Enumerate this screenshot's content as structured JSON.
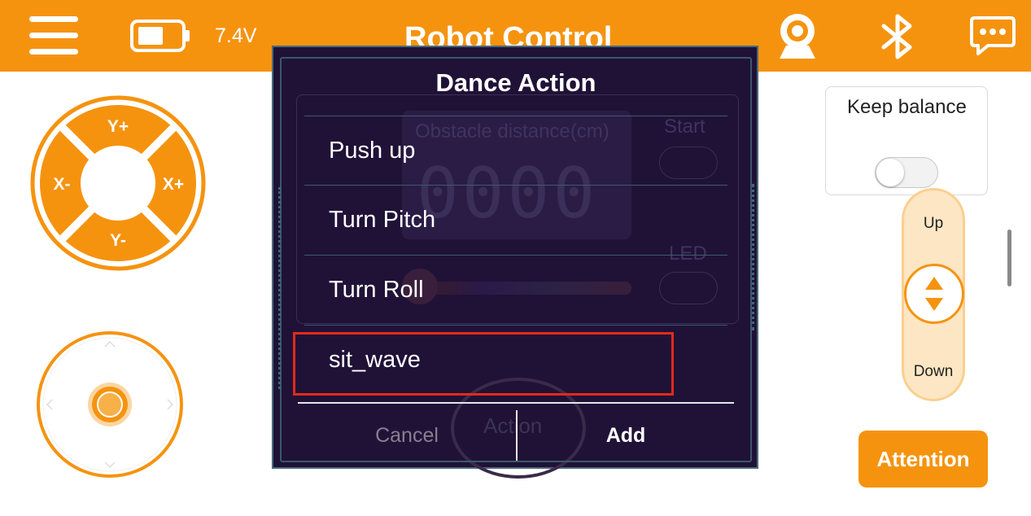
{
  "header": {
    "voltage": "7.4V",
    "title": "Robot Control",
    "icons": [
      "menu-icon",
      "battery-icon",
      "camera-icon",
      "bluetooth-icon",
      "chat-icon"
    ]
  },
  "dpad": {
    "up": "Y+",
    "down": "Y-",
    "left": "X-",
    "right": "X+"
  },
  "keep_balance": {
    "label": "Keep balance",
    "enabled": false
  },
  "height_control": {
    "up": "Up",
    "down": "Down"
  },
  "attention_button": "Attention",
  "background_panel": {
    "obstacle_label": "Obstacle distance(cm)",
    "distance_readout": "0000",
    "start_label": "Start",
    "led_label": "LED",
    "action_label": "Action"
  },
  "dialog": {
    "title": "Dance Action",
    "items": [
      {
        "label": "Push up"
      },
      {
        "label": "Turn Pitch"
      },
      {
        "label": "Turn Roll"
      },
      {
        "label": "sit_wave"
      }
    ],
    "cancel_label": "Cancel",
    "add_label": "Add"
  },
  "colors": {
    "accent": "#f5930f",
    "dialog_bg": "#201237",
    "highlight": "#e32a1a"
  }
}
